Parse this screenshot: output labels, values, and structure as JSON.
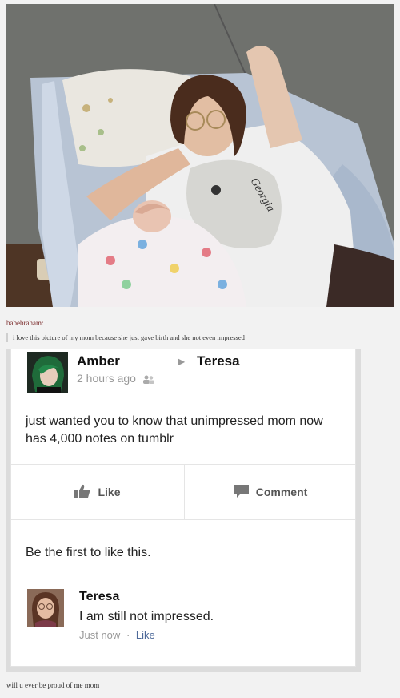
{
  "tumblr": {
    "username": "babebraham:",
    "quote": "i love this picture of my mom because she just gave birth and she not even impressed",
    "reply": "will u ever be proud of me mom"
  },
  "photo": {
    "shirt_text": "Georgia"
  },
  "post": {
    "author": "Amber",
    "recipient": "Teresa",
    "timestamp": "2 hours ago",
    "audience_icon": "friends-icon",
    "text": "just wanted you to know that unimpressed mom now has 4,000 notes on tumblr"
  },
  "actions": {
    "like_label": "Like",
    "comment_label": "Comment"
  },
  "likes_summary": "Be the first to like this.",
  "comment": {
    "author": "Teresa",
    "text": "I am still not impressed.",
    "time": "Just now",
    "separator": "·",
    "like_label": "Like"
  },
  "colors": {
    "link": "#4e6a9a",
    "username": "#7a2a2a",
    "muted": "#999999"
  }
}
